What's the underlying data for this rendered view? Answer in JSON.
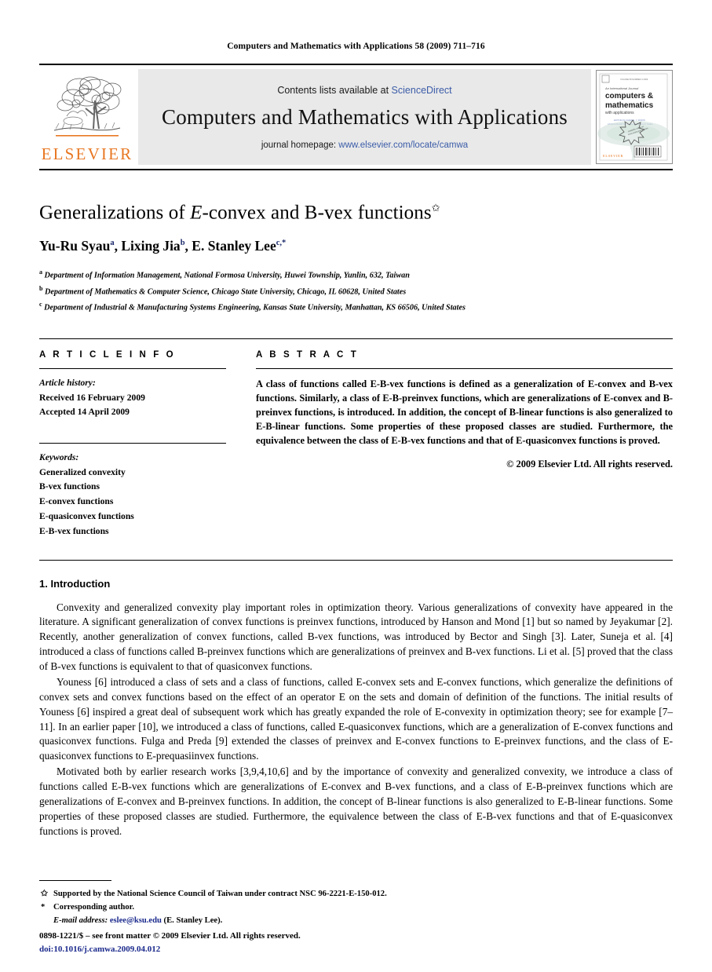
{
  "running_head": "Computers and Mathematics with Applications 58 (2009) 711–716",
  "masthead": {
    "contents_prefix": "Contents lists available at ",
    "contents_link": "ScienceDirect",
    "journal_title": "Computers and Mathematics with Applications",
    "homepage_prefix": "journal homepage: ",
    "homepage_link": "www.elsevier.com/locate/camwa",
    "publisher_wordmark": "ELSEVIER",
    "publisher_color": "#E87722",
    "link_color": "#3b5ca8",
    "cover": {
      "line1": "An International Journal",
      "line2": "computers &",
      "line3": "mathematics",
      "line4": "with applications",
      "badge": "available online at",
      "footer": "ELSEVIER"
    }
  },
  "title": {
    "part1": "Generalizations of ",
    "italic_e": "E",
    "part2": "-convex and B-vex functions",
    "star": "✩"
  },
  "authors": {
    "a1": "Yu-Ru Syau",
    "a1_sup": "a",
    "sep1": ", ",
    "a2": "Lixing Jia",
    "a2_sup": "b",
    "sep2": ", ",
    "a3": "E. Stanley Lee",
    "a3_sup": "c,",
    "a3_star": "*"
  },
  "affiliations": [
    {
      "mark": "a",
      "text": "Department of Information Management, National Formosa University, Huwei Township, Yunlin, 632, Taiwan"
    },
    {
      "mark": "b",
      "text": "Department of Mathematics & Computer Science, Chicago State University, Chicago, IL 60628, United States"
    },
    {
      "mark": "c",
      "text": "Department of Industrial & Manufacturing Systems Engineering, Kansas State University, Manhattan, KS 66506, United States"
    }
  ],
  "article_info": {
    "heading": "A R T I C L E    I N F O",
    "history_label": "Article history:",
    "history": [
      "Received 16 February 2009",
      "Accepted 14 April 2009"
    ],
    "keywords_label": "Keywords:",
    "keywords": [
      "Generalized convexity",
      "B-vex functions",
      "E-convex functions",
      "E-quasiconvex functions",
      "E-B-vex functions"
    ]
  },
  "abstract": {
    "heading": "A B S T R A C T",
    "text": "A class of functions called E-B-vex functions is defined as a generalization of E-convex and B-vex functions. Similarly, a class of E-B-preinvex functions, which are generalizations of E-convex and B-preinvex functions, is introduced. In addition, the concept of B-linear functions is also generalized to E-B-linear functions. Some properties of these proposed classes are studied. Furthermore, the equivalence between the class of E-B-vex functions and that of E-quasiconvex functions is proved.",
    "copyright": "© 2009 Elsevier Ltd. All rights reserved."
  },
  "introduction": {
    "heading": "1. Introduction",
    "paragraphs": [
      "Convexity and generalized convexity play important roles in optimization theory. Various generalizations of convexity have appeared in the literature. A significant generalization of convex functions is preinvex functions, introduced by Hanson and Mond [1] but so named by Jeyakumar [2]. Recently, another generalization of convex functions, called B-vex functions, was introduced by Bector and Singh [3]. Later, Suneja et al. [4] introduced a class of functions called B-preinvex functions which are generalizations of preinvex and B-vex functions. Li et al. [5] proved that the class of B-vex functions is equivalent to that of quasiconvex functions.",
      "Youness [6] introduced a class of sets and a class of functions, called E-convex sets and E-convex functions, which generalize the definitions of convex sets and convex functions based on the effect of an operator E on the sets and domain of definition of the functions. The initial results of Youness [6] inspired a great deal of subsequent work which has greatly expanded the role of E-convexity in optimization theory; see for example [7–11]. In an earlier paper [10], we introduced a class of functions, called E-quasiconvex functions, which are a generalization of E-convex functions and quasiconvex functions. Fulga and Preda [9] extended the classes of preinvex and E-convex functions to E-preinvex functions, and the class of E-quasiconvex functions to E-prequasiinvex functions.",
      "Motivated both by earlier research works [3,9,4,10,6] and by the importance of convexity and generalized convexity, we introduce a class of functions called E-B-vex functions which are generalizations of E-convex and B-vex functions, and a class of E-B-preinvex functions which are generalizations of E-convex and B-preinvex functions. In addition, the concept of B-linear functions is also generalized to E-B-linear functions. Some properties of these proposed classes are studied. Furthermore, the equivalence between the class of E-B-vex functions and that of E-quasiconvex functions is proved."
    ]
  },
  "footnotes": {
    "star_mark": "✩",
    "star_text": "Supported by the National Science Council of Taiwan under contract NSC 96-2221-E-150-012.",
    "corr_mark": "*",
    "corr_text": "Corresponding author.",
    "email_label": "E-mail address:",
    "email": "eslee@ksu.edu",
    "email_owner": "(E. Stanley Lee)."
  },
  "imprint": {
    "issn_line": "0898-1221/$ – see front matter © 2009 Elsevier Ltd. All rights reserved.",
    "doi_line": "doi:10.1016/j.camwa.2009.04.012"
  }
}
